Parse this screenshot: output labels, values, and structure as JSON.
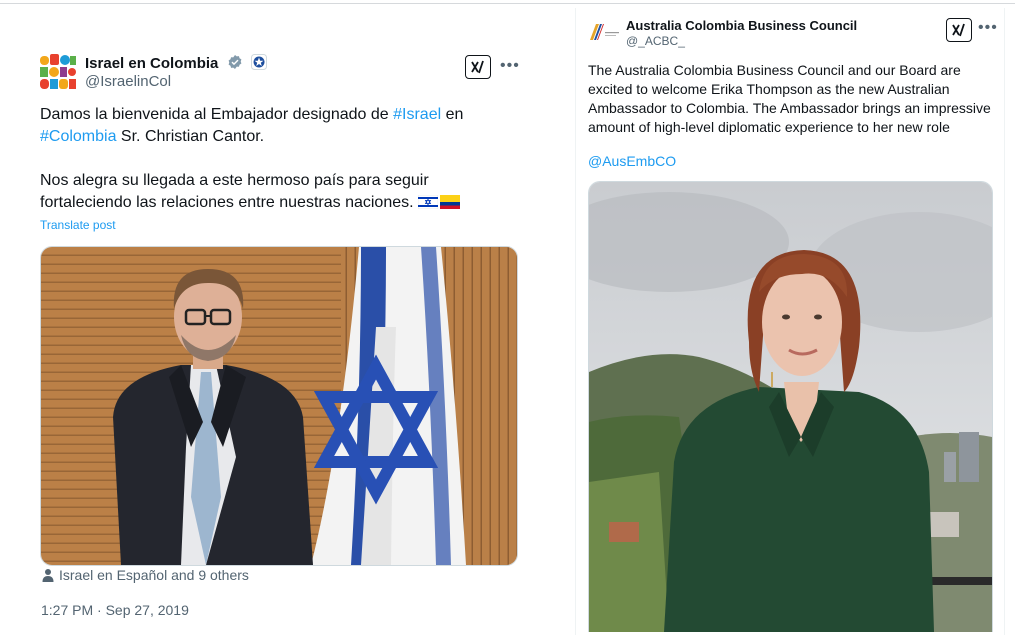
{
  "left_post": {
    "author": {
      "display_name": "Israel en Colombia",
      "handle": "@IsraelinCol",
      "avatar": "colorful-logo-avatar",
      "verified_icon": "verified-badge-icon",
      "affiliate_icon": "affiliate-badge-icon"
    },
    "text": {
      "p1_a": "Damos la bienvenida al Embajador designado de ",
      "hashtag_israel": "#Israel",
      "p1_b": " en",
      "hashtag_colombia": "#Colombia",
      "p1_c": " Sr. Christian Cantor.",
      "p2": "Nos alegra su llegada a este hermoso país para seguir fortaleciendo las relaciones entre nuestras naciones.",
      "flags": [
        "israel-flag-emoji",
        "colombia-flag-emoji"
      ]
    },
    "translate_label": "Translate post",
    "tagged": "Israel en Español and 9 others",
    "timestamp": "1:27 PM · Sep 27, 2019",
    "media": "photo-man-in-suit-with-israeli-flag"
  },
  "right_post": {
    "author": {
      "display_name": "Australia Colombia Business Council",
      "handle": "@_ACBC_",
      "avatar": "acbc-logo-avatar"
    },
    "text": "The Australia Colombia Business Council and our Board are excited to welcome Erika Thompson as the new Australian Ambassador to Colombia. The Ambassador brings an impressive amount of high-level diplomatic experience to her new role",
    "mention": "@AusEmbCO",
    "media": "photo-woman-in-green-blouse-mountains"
  },
  "icons": {
    "grok": "grok-icon",
    "more": "more-options-icon",
    "person": "person-icon"
  },
  "colors": {
    "link": "#1d9bf0",
    "text": "#0f1419",
    "muted": "#536471",
    "verified": "#829aab",
    "israel_blue": "#0038b8",
    "colombia_yellow": "#fcd116",
    "colombia_blue": "#003893",
    "colombia_red": "#ce1126"
  }
}
